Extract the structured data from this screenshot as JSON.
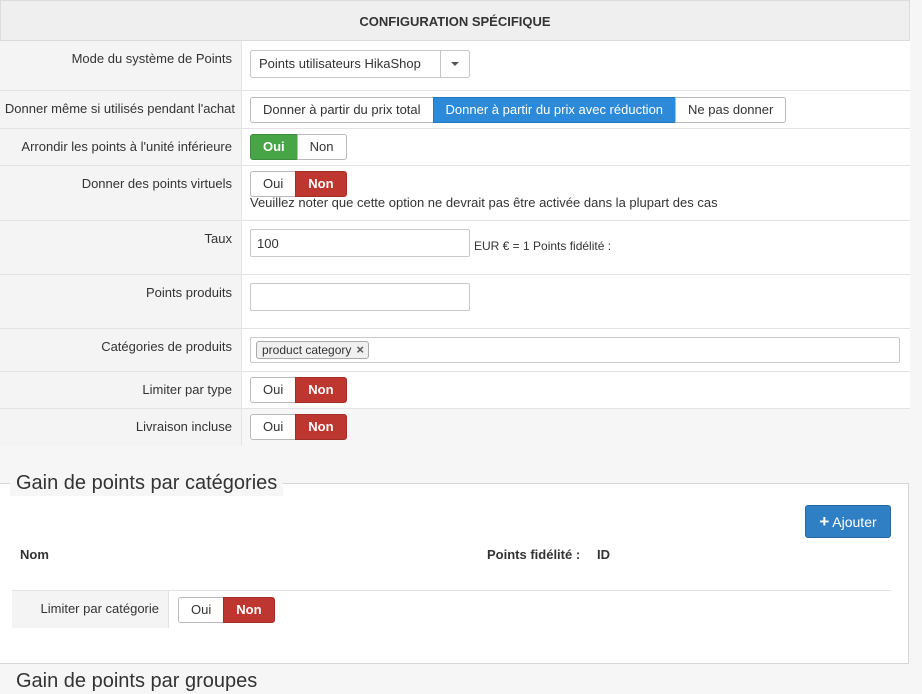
{
  "header": {
    "title": "CONFIGURATION SPÉCIFIQUE"
  },
  "fields": {
    "mode": {
      "label": "Mode du système de Points",
      "value": "Points utilisateurs HikaShop"
    },
    "give_even_used": {
      "label": "Donner même si utilisés pendant l'achat",
      "options": [
        "Donner à partir du prix total",
        "Donner à partir du prix avec réduction",
        "Ne pas donner"
      ],
      "selected": "Donner à partir du prix avec réduction"
    },
    "round_down": {
      "label": "Arrondir les points à l'unité inférieure",
      "yes": "Oui",
      "no": "Non",
      "selected": "Oui"
    },
    "virtual_points": {
      "label": "Donner des points virtuels",
      "yes": "Oui",
      "no": "Non",
      "selected": "Non",
      "note": "Veuillez noter que cette option ne devrait pas être activée dans la plupart des cas"
    },
    "rate": {
      "label": "Taux",
      "value": "100",
      "suffix": "EUR € = 1 Points fidélité :"
    },
    "product_points": {
      "label": "Points produits",
      "value": ""
    },
    "product_categories": {
      "label": "Catégories de produits",
      "tag": "product category",
      "tag_remove": "×"
    },
    "limit_type": {
      "label": "Limiter par type",
      "yes": "Oui",
      "no": "Non",
      "selected": "Non"
    },
    "shipping_included": {
      "label": "Livraison incluse",
      "yes": "Oui",
      "no": "Non",
      "selected": "Non"
    }
  },
  "category_section": {
    "legend": "Gain de points par catégories",
    "add_button": "Ajouter",
    "add_icon": "+",
    "columns": {
      "name": "Nom",
      "points": "Points fidélité :",
      "id": "ID"
    },
    "limit_category": {
      "label": "Limiter par catégorie",
      "yes": "Oui",
      "no": "Non",
      "selected": "Non"
    }
  },
  "group_section": {
    "legend": "Gain de points par groupes"
  },
  "colors": {
    "green": "#47a447",
    "red": "#bd362f",
    "blue": "#2d8ad8"
  }
}
